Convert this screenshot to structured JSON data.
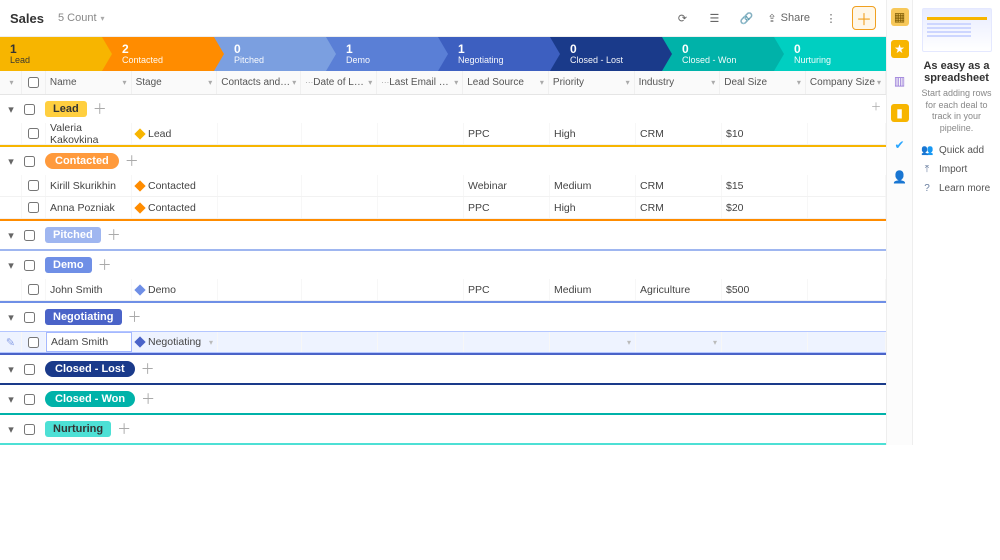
{
  "header": {
    "title": "Sales",
    "count": "5 Count",
    "share": "Share"
  },
  "pipeline": [
    {
      "count": "1",
      "label": "Lead"
    },
    {
      "count": "2",
      "label": "Contacted"
    },
    {
      "count": "0",
      "label": "Pitched"
    },
    {
      "count": "1",
      "label": "Demo"
    },
    {
      "count": "1",
      "label": "Negotiating"
    },
    {
      "count": "0",
      "label": "Closed - Lost"
    },
    {
      "count": "0",
      "label": "Closed - Won"
    },
    {
      "count": "0",
      "label": "Nurturing"
    }
  ],
  "columns": {
    "name": "Name",
    "stage": "Stage",
    "contacts": "Contacts and organizations",
    "date_last": "Date of Last Email",
    "last_from": "Last Email From",
    "lead_source": "Lead Source",
    "priority": "Priority",
    "industry": "Industry",
    "deal_size": "Deal Size",
    "company_size": "Company Size"
  },
  "groups": {
    "lead": "Lead",
    "contacted": "Contacted",
    "pitched": "Pitched",
    "demo": "Demo",
    "negotiating": "Negotiating",
    "closed_lost": "Closed - Lost",
    "closed_won": "Closed - Won",
    "nurturing": "Nurturing"
  },
  "rows": {
    "lead1": {
      "name": "Valeria Kakovkina",
      "stage": "Lead",
      "source": "PPC",
      "priority": "High",
      "industry": "CRM",
      "deal": "$10"
    },
    "c1": {
      "name": "Kirill Skurikhin",
      "stage": "Contacted",
      "source": "Webinar",
      "priority": "Medium",
      "industry": "CRM",
      "deal": "$15"
    },
    "c2": {
      "name": "Anna Pozniak",
      "stage": "Contacted",
      "source": "PPC",
      "priority": "High",
      "industry": "CRM",
      "deal": "$20"
    },
    "d1": {
      "name": "John Smith",
      "stage": "Demo",
      "source": "PPC",
      "priority": "Medium",
      "industry": "Agriculture",
      "deal": "$500"
    },
    "n1": {
      "name": "Adam Smith",
      "stage": "Negotiating"
    }
  },
  "panel": {
    "title": "As easy as a spreadsheet",
    "sub": "Start adding rows for each deal to track in your pipeline.",
    "quick": "Quick add",
    "import": "Import",
    "learn": "Learn more"
  }
}
